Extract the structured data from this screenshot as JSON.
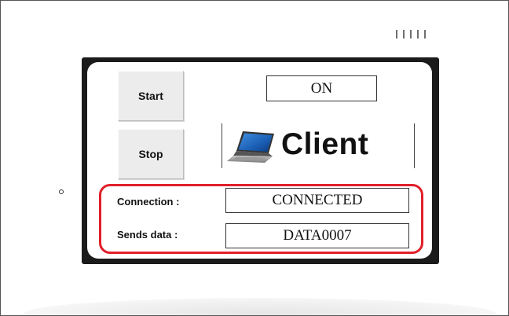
{
  "controls": {
    "start_label": "Start",
    "stop_label": "Stop"
  },
  "status": {
    "power_value": "ON"
  },
  "client": {
    "title": "Client",
    "icon": "laptop-icon"
  },
  "connection": {
    "label": "Connection :",
    "value": "CONNECTED"
  },
  "sends_data": {
    "label": "Sends data :",
    "value": "DATA0007"
  },
  "colors": {
    "highlight": "#e0202a",
    "bezel": "#1b1b1b",
    "button_face": "#ececec"
  }
}
